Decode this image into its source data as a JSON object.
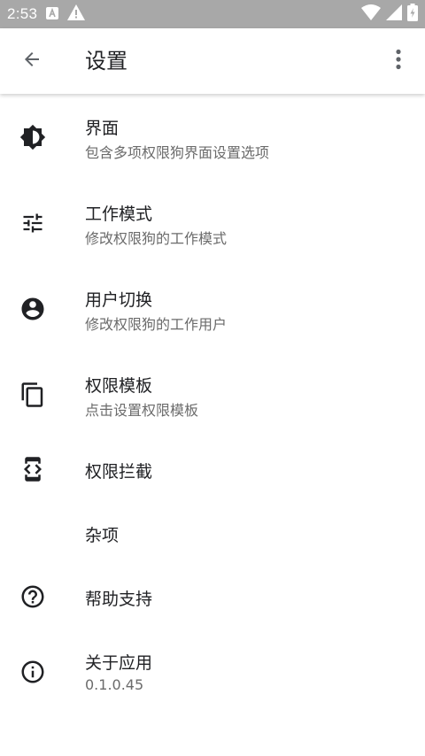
{
  "status_bar": {
    "time": "2:53",
    "icons": [
      "app-notification-icon",
      "warning-icon",
      "wifi-icon",
      "signal-icon",
      "battery-charging-icon"
    ]
  },
  "app_bar": {
    "title": "设置",
    "back_icon": "arrow-back-icon",
    "more_icon": "more-vert-icon"
  },
  "settings": [
    {
      "label": "界面",
      "subtitle": "包含多项权限狗界面设置选项",
      "icon": "brightness-icon"
    },
    {
      "label": "工作模式",
      "subtitle": "修改权限狗的工作模式",
      "icon": "tune-icon"
    },
    {
      "label": "用户切换",
      "subtitle": "修改权限狗的工作用户",
      "icon": "account-circle-icon"
    },
    {
      "label": "权限模板",
      "subtitle": "点击设置权限模板",
      "icon": "copy-icon"
    },
    {
      "label": "权限拦截",
      "icon": "developer-mode-icon"
    },
    {
      "label": "杂项"
    },
    {
      "label": "帮助支持",
      "icon": "help-icon"
    },
    {
      "label": "关于应用",
      "subtitle": "0.1.0.45",
      "icon": "info-icon"
    }
  ],
  "colors": {
    "status_bar": "#a8a8a8",
    "icon": "#202124",
    "subtitle": "#6b6b6b"
  }
}
